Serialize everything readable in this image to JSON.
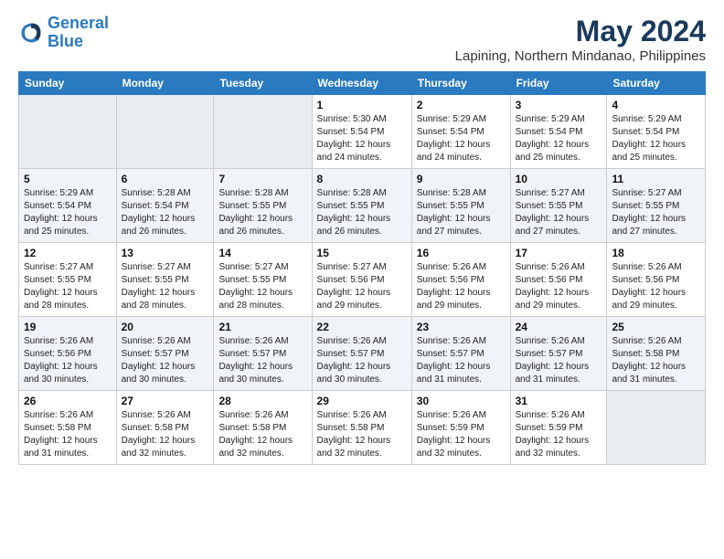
{
  "logo": {
    "line1": "General",
    "line2": "Blue"
  },
  "title": "May 2024",
  "location": "Lapining, Northern Mindanao, Philippines",
  "days_header": [
    "Sunday",
    "Monday",
    "Tuesday",
    "Wednesday",
    "Thursday",
    "Friday",
    "Saturday"
  ],
  "weeks": [
    [
      {
        "num": "",
        "info": ""
      },
      {
        "num": "",
        "info": ""
      },
      {
        "num": "",
        "info": ""
      },
      {
        "num": "1",
        "info": "Sunrise: 5:30 AM\nSunset: 5:54 PM\nDaylight: 12 hours\nand 24 minutes."
      },
      {
        "num": "2",
        "info": "Sunrise: 5:29 AM\nSunset: 5:54 PM\nDaylight: 12 hours\nand 24 minutes."
      },
      {
        "num": "3",
        "info": "Sunrise: 5:29 AM\nSunset: 5:54 PM\nDaylight: 12 hours\nand 25 minutes."
      },
      {
        "num": "4",
        "info": "Sunrise: 5:29 AM\nSunset: 5:54 PM\nDaylight: 12 hours\nand 25 minutes."
      }
    ],
    [
      {
        "num": "5",
        "info": "Sunrise: 5:29 AM\nSunset: 5:54 PM\nDaylight: 12 hours\nand 25 minutes."
      },
      {
        "num": "6",
        "info": "Sunrise: 5:28 AM\nSunset: 5:54 PM\nDaylight: 12 hours\nand 26 minutes."
      },
      {
        "num": "7",
        "info": "Sunrise: 5:28 AM\nSunset: 5:55 PM\nDaylight: 12 hours\nand 26 minutes."
      },
      {
        "num": "8",
        "info": "Sunrise: 5:28 AM\nSunset: 5:55 PM\nDaylight: 12 hours\nand 26 minutes."
      },
      {
        "num": "9",
        "info": "Sunrise: 5:28 AM\nSunset: 5:55 PM\nDaylight: 12 hours\nand 27 minutes."
      },
      {
        "num": "10",
        "info": "Sunrise: 5:27 AM\nSunset: 5:55 PM\nDaylight: 12 hours\nand 27 minutes."
      },
      {
        "num": "11",
        "info": "Sunrise: 5:27 AM\nSunset: 5:55 PM\nDaylight: 12 hours\nand 27 minutes."
      }
    ],
    [
      {
        "num": "12",
        "info": "Sunrise: 5:27 AM\nSunset: 5:55 PM\nDaylight: 12 hours\nand 28 minutes."
      },
      {
        "num": "13",
        "info": "Sunrise: 5:27 AM\nSunset: 5:55 PM\nDaylight: 12 hours\nand 28 minutes."
      },
      {
        "num": "14",
        "info": "Sunrise: 5:27 AM\nSunset: 5:55 PM\nDaylight: 12 hours\nand 28 minutes."
      },
      {
        "num": "15",
        "info": "Sunrise: 5:27 AM\nSunset: 5:56 PM\nDaylight: 12 hours\nand 29 minutes."
      },
      {
        "num": "16",
        "info": "Sunrise: 5:26 AM\nSunset: 5:56 PM\nDaylight: 12 hours\nand 29 minutes."
      },
      {
        "num": "17",
        "info": "Sunrise: 5:26 AM\nSunset: 5:56 PM\nDaylight: 12 hours\nand 29 minutes."
      },
      {
        "num": "18",
        "info": "Sunrise: 5:26 AM\nSunset: 5:56 PM\nDaylight: 12 hours\nand 29 minutes."
      }
    ],
    [
      {
        "num": "19",
        "info": "Sunrise: 5:26 AM\nSunset: 5:56 PM\nDaylight: 12 hours\nand 30 minutes."
      },
      {
        "num": "20",
        "info": "Sunrise: 5:26 AM\nSunset: 5:57 PM\nDaylight: 12 hours\nand 30 minutes."
      },
      {
        "num": "21",
        "info": "Sunrise: 5:26 AM\nSunset: 5:57 PM\nDaylight: 12 hours\nand 30 minutes."
      },
      {
        "num": "22",
        "info": "Sunrise: 5:26 AM\nSunset: 5:57 PM\nDaylight: 12 hours\nand 30 minutes."
      },
      {
        "num": "23",
        "info": "Sunrise: 5:26 AM\nSunset: 5:57 PM\nDaylight: 12 hours\nand 31 minutes."
      },
      {
        "num": "24",
        "info": "Sunrise: 5:26 AM\nSunset: 5:57 PM\nDaylight: 12 hours\nand 31 minutes."
      },
      {
        "num": "25",
        "info": "Sunrise: 5:26 AM\nSunset: 5:58 PM\nDaylight: 12 hours\nand 31 minutes."
      }
    ],
    [
      {
        "num": "26",
        "info": "Sunrise: 5:26 AM\nSunset: 5:58 PM\nDaylight: 12 hours\nand 31 minutes."
      },
      {
        "num": "27",
        "info": "Sunrise: 5:26 AM\nSunset: 5:58 PM\nDaylight: 12 hours\nand 32 minutes."
      },
      {
        "num": "28",
        "info": "Sunrise: 5:26 AM\nSunset: 5:58 PM\nDaylight: 12 hours\nand 32 minutes."
      },
      {
        "num": "29",
        "info": "Sunrise: 5:26 AM\nSunset: 5:58 PM\nDaylight: 12 hours\nand 32 minutes."
      },
      {
        "num": "30",
        "info": "Sunrise: 5:26 AM\nSunset: 5:59 PM\nDaylight: 12 hours\nand 32 minutes."
      },
      {
        "num": "31",
        "info": "Sunrise: 5:26 AM\nSunset: 5:59 PM\nDaylight: 12 hours\nand 32 minutes."
      },
      {
        "num": "",
        "info": ""
      }
    ]
  ]
}
